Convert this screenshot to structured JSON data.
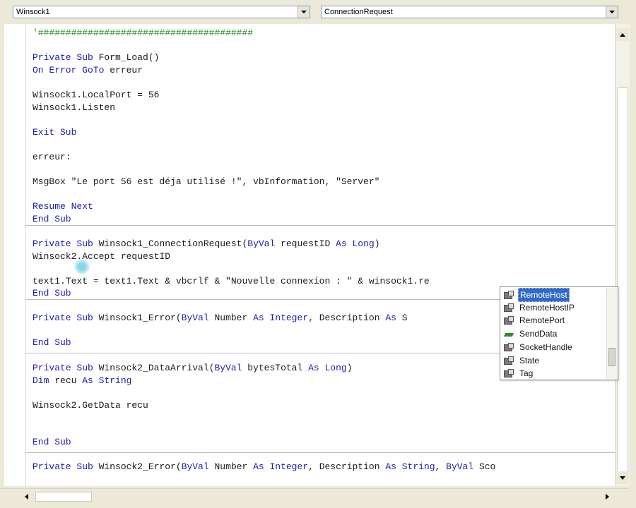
{
  "object_combo": {
    "value": "Winsock1"
  },
  "procedure_combo": {
    "value": "ConnectionRequest"
  },
  "code_lines": [
    {
      "id": "l1",
      "segs": [
        {
          "t": "'#######################################",
          "c": "cm"
        }
      ]
    },
    {
      "id": "l2",
      "segs": [
        {
          "t": "Private Sub ",
          "c": "kw"
        },
        {
          "t": "Form_Load()",
          "c": "tx"
        }
      ]
    },
    {
      "id": "l3",
      "segs": [
        {
          "t": "On Error GoTo ",
          "c": "kw"
        },
        {
          "t": "erreur",
          "c": "tx"
        }
      ]
    },
    {
      "id": "l4",
      "segs": [
        {
          "t": "Winsock1.LocalPort = 56",
          "c": "tx"
        }
      ]
    },
    {
      "id": "l5",
      "segs": [
        {
          "t": "Winsock1.Listen",
          "c": "tx"
        }
      ]
    },
    {
      "id": "l6",
      "segs": [
        {
          "t": "Exit Sub",
          "c": "kw"
        }
      ]
    },
    {
      "id": "l7",
      "segs": [
        {
          "t": "erreur:",
          "c": "tx"
        }
      ]
    },
    {
      "id": "l8",
      "segs": [
        {
          "t": "MsgBox \"Le port 56 est déja utilisé !\", vbInformation, \"Server\"",
          "c": "tx"
        }
      ]
    },
    {
      "id": "l9",
      "segs": [
        {
          "t": "Resume Next",
          "c": "kw"
        }
      ]
    },
    {
      "id": "l10",
      "segs": [
        {
          "t": "End Sub",
          "c": "kw"
        }
      ]
    },
    {
      "id": "l11",
      "segs": [
        {
          "t": "Private Sub ",
          "c": "kw"
        },
        {
          "t": "Winsock1_ConnectionRequest(",
          "c": "tx"
        },
        {
          "t": "ByVal ",
          "c": "kw"
        },
        {
          "t": "requestID ",
          "c": "tx"
        },
        {
          "t": "As Long",
          "c": "kw"
        },
        {
          "t": ")",
          "c": "tx"
        }
      ]
    },
    {
      "id": "l12",
      "segs": [
        {
          "t": "Winsock2.Accept requestID",
          "c": "tx"
        }
      ]
    },
    {
      "id": "l13",
      "segs": [
        {
          "t": "text1.Text = text1.Text & vbcrlf & \"Nouvelle connexion : \" & winsock1.re",
          "c": "tx"
        }
      ]
    },
    {
      "id": "l14",
      "segs": [
        {
          "t": "End Sub",
          "c": "kw"
        }
      ]
    },
    {
      "id": "l15",
      "segs": [
        {
          "t": "Private Sub ",
          "c": "kw"
        },
        {
          "t": "Winsock1_Error(",
          "c": "tx"
        },
        {
          "t": "ByVal ",
          "c": "kw"
        },
        {
          "t": "Number ",
          "c": "tx"
        },
        {
          "t": "As Integer",
          "c": "kw"
        },
        {
          "t": ", Description ",
          "c": "tx"
        },
        {
          "t": "As ",
          "c": "kw"
        },
        {
          "t": "S",
          "c": "tx"
        }
      ]
    },
    {
      "id": "l16",
      "segs": [
        {
          "t": "End Sub",
          "c": "kw"
        }
      ]
    },
    {
      "id": "l17",
      "segs": [
        {
          "t": "Private Sub ",
          "c": "kw"
        },
        {
          "t": "Winsock2_DataArrival(",
          "c": "tx"
        },
        {
          "t": "ByVal ",
          "c": "kw"
        },
        {
          "t": "bytesTotal ",
          "c": "tx"
        },
        {
          "t": "As Long",
          "c": "kw"
        },
        {
          "t": ")",
          "c": "tx"
        }
      ]
    },
    {
      "id": "l18",
      "segs": [
        {
          "t": "Dim ",
          "c": "kw"
        },
        {
          "t": "recu ",
          "c": "tx"
        },
        {
          "t": "As String",
          "c": "kw"
        }
      ]
    },
    {
      "id": "l19",
      "segs": [
        {
          "t": "Winsock2.GetData recu",
          "c": "tx"
        }
      ]
    },
    {
      "id": "l20",
      "segs": [
        {
          "t": "End Sub",
          "c": "kw"
        }
      ]
    },
    {
      "id": "l21",
      "segs": [
        {
          "t": "Private Sub ",
          "c": "kw"
        },
        {
          "t": "Winsock2_Error(",
          "c": "tx"
        },
        {
          "t": "ByVal ",
          "c": "kw"
        },
        {
          "t": "Number ",
          "c": "tx"
        },
        {
          "t": "As Integer",
          "c": "kw"
        },
        {
          "t": ", Description ",
          "c": "tx"
        },
        {
          "t": "As String",
          "c": "kw"
        },
        {
          "t": ", ",
          "c": "tx"
        },
        {
          "t": "ByVal ",
          "c": "kw"
        },
        {
          "t": "Sco",
          "c": "tx"
        }
      ]
    }
  ],
  "autocomplete": {
    "items": [
      {
        "label": "RemoteHost",
        "kind": "property",
        "icon": "property-icon",
        "selected": true
      },
      {
        "label": "RemoteHostIP",
        "kind": "property",
        "icon": "property-icon",
        "selected": false
      },
      {
        "label": "RemotePort",
        "kind": "property",
        "icon": "property-icon",
        "selected": false
      },
      {
        "label": "SendData",
        "kind": "method",
        "icon": "method-icon",
        "selected": false
      },
      {
        "label": "SocketHandle",
        "kind": "property",
        "icon": "property-icon",
        "selected": false
      },
      {
        "label": "State",
        "kind": "property",
        "icon": "property-icon",
        "selected": false
      },
      {
        "label": "Tag",
        "kind": "property",
        "icon": "property-icon",
        "selected": false
      }
    ]
  },
  "colors": {
    "keyword": "#1c1ca8",
    "text": "#1a1a1a",
    "comment": "#1f8a1f",
    "selection": "#316ac5"
  }
}
